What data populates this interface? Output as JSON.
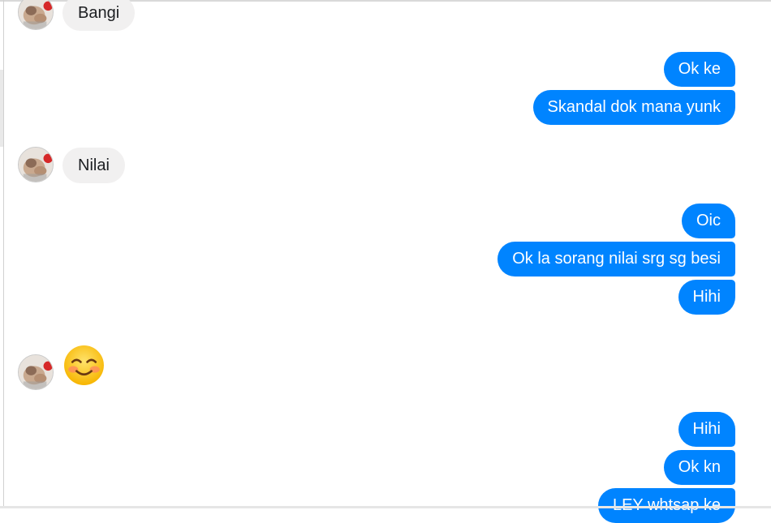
{
  "conversation": {
    "messages": [
      {
        "sender": "contact",
        "text": "Bangi"
      },
      {
        "sender": "me",
        "text": "Ok ke"
      },
      {
        "sender": "me",
        "text": "Skandal dok mana yunk"
      },
      {
        "sender": "contact",
        "text": "Nilai"
      },
      {
        "sender": "me",
        "text": "Oic"
      },
      {
        "sender": "me",
        "text": "Ok la sorang nilai srg sg besi"
      },
      {
        "sender": "me",
        "text": "Hihi"
      },
      {
        "sender": "contact",
        "emoji": "smiling-face-with-smiling-eyes"
      },
      {
        "sender": "me",
        "text": "Hihi"
      },
      {
        "sender": "me",
        "text": "Ok kn"
      },
      {
        "sender": "me",
        "text": "LEY whtsap ke"
      }
    ]
  },
  "colors": {
    "outgoing_bubble": "#0084ff",
    "incoming_bubble": "#f1f0f0",
    "outgoing_text": "#ffffff",
    "incoming_text": "#1c1e21"
  },
  "icons": {
    "contact_avatar": "avatar-photo",
    "reaction_emoji": "smiling-face-emoji"
  }
}
